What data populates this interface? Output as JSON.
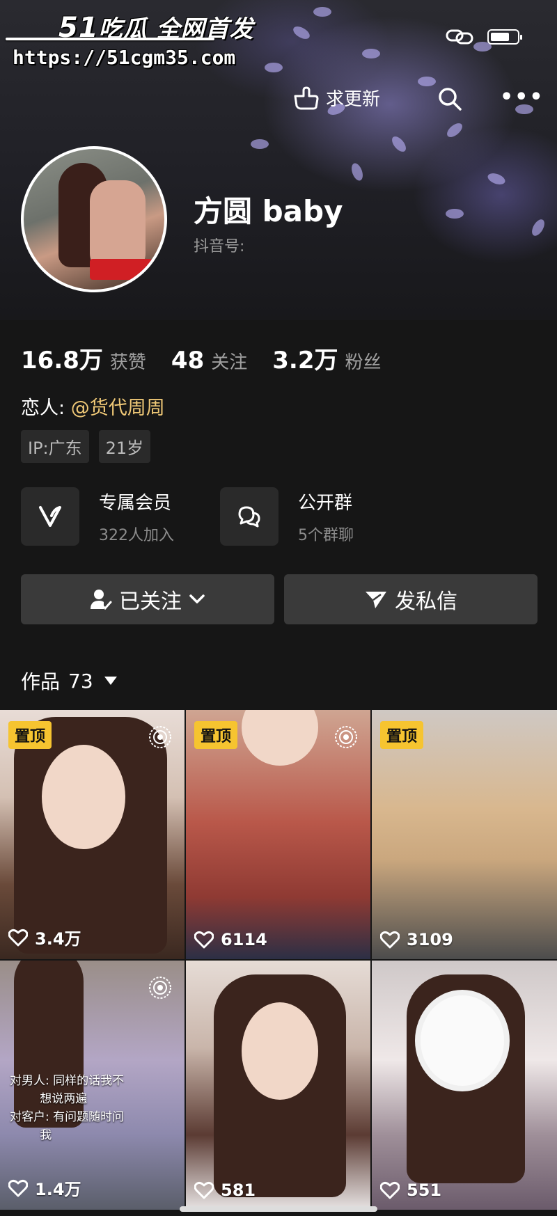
{
  "watermark": {
    "logo_num": "51",
    "logo_text": "吃瓜 全网首发",
    "url": "https://51cgm35.com"
  },
  "header": {
    "request_update_label": "求更新"
  },
  "profile": {
    "name": "方圆 baby",
    "douyin_id_label": "抖音号:",
    "stats": [
      {
        "value": "16.8万",
        "label": "获赞"
      },
      {
        "value": "48",
        "label": "关注"
      },
      {
        "value": "3.2万",
        "label": "粉丝"
      }
    ],
    "lover_label": "恋人:",
    "lover_value": "@货代周周",
    "tags": [
      "IP:广东",
      "21岁"
    ],
    "features": [
      {
        "title": "专属会员",
        "subtitle": "322人加入",
        "icon": "v-member-icon"
      },
      {
        "title": "公开群",
        "subtitle": "5个群聊",
        "icon": "chat-group-icon"
      }
    ],
    "follow_button": "已关注",
    "message_button": "发私信",
    "works_label": "作品",
    "works_count": "73"
  },
  "videos": [
    {
      "pinned": true,
      "pin_label": "置顶",
      "likes": "3.4万",
      "live_icon": true
    },
    {
      "pinned": true,
      "pin_label": "置顶",
      "likes": "6114",
      "live_icon": true
    },
    {
      "pinned": true,
      "pin_label": "置顶",
      "likes": "3109",
      "live_icon": false
    },
    {
      "pinned": false,
      "likes": "1.4万",
      "live_icon": true,
      "caption": [
        "对男人: 同样的话我不",
        "        想说两遍",
        "对客户: 有问题随时问",
        "        我"
      ]
    },
    {
      "pinned": false,
      "likes": "581",
      "live_icon": false
    },
    {
      "pinned": false,
      "likes": "551",
      "live_icon": false
    }
  ],
  "colors": {
    "accent_gold": "#f0c977",
    "pin_yellow": "#f6c430",
    "background": "#161616"
  }
}
